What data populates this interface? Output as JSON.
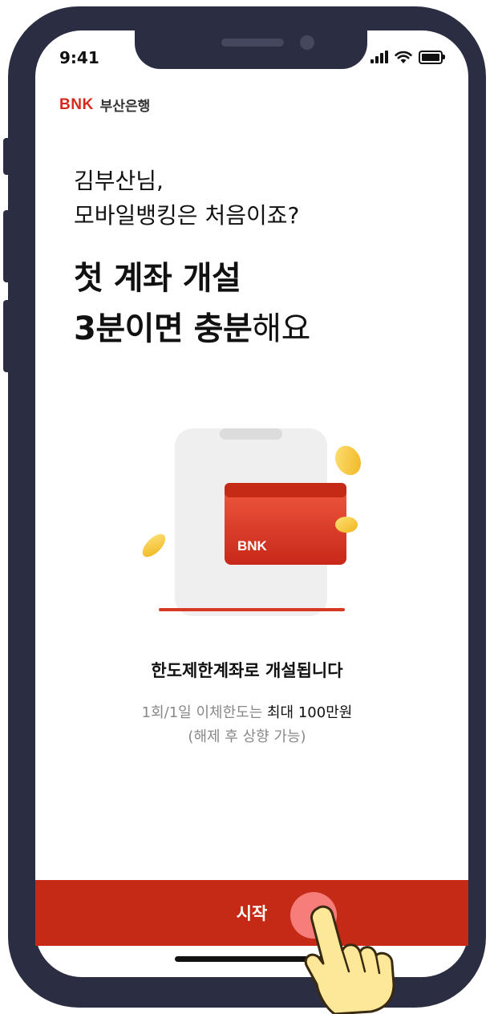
{
  "status_bar": {
    "time": "9:41"
  },
  "bank": {
    "logo_mark": "BNK",
    "name": "부산은행"
  },
  "greeting": {
    "line1": "김부산님,",
    "line2": "모바일뱅킹은 처음이죠?"
  },
  "headline": {
    "line1": "첫 계좌 개설",
    "line2_bold": "3분이면 충분",
    "line2_light": "해요"
  },
  "illustration": {
    "card_brand": "BNK"
  },
  "notice": {
    "title": "한도제한계좌로 개설됩니다",
    "limit_prefix": "1회/1일 이체한도는 ",
    "limit_value": "최대 100만원",
    "note": "(해제 후 상향 가능)"
  },
  "cta": {
    "start_label": "시작"
  },
  "icons": [
    "signal-icon",
    "wifi-icon",
    "battery-icon",
    "tap-hand-icon"
  ],
  "colors": {
    "accent": "#c52a16",
    "logo": "#d42a1e",
    "frame": "#2b2d42",
    "coin": "#f4c020"
  }
}
